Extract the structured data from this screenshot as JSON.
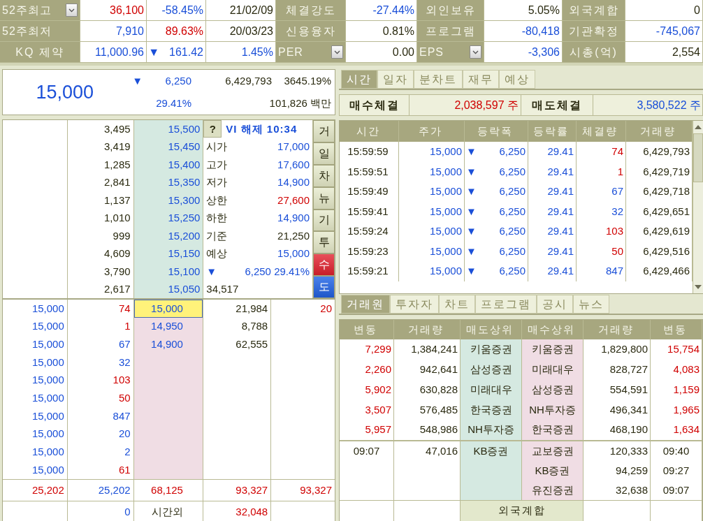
{
  "info_bar": {
    "rows": [
      {
        "cells": [
          {
            "kind": "select",
            "text": "52주최고"
          },
          {
            "kind": "value",
            "text": "36,100",
            "color": "#d00000"
          },
          {
            "kind": "value",
            "text": "-58.45%",
            "color": "#1a4fd8"
          },
          {
            "kind": "value",
            "text": "21/02/09",
            "color": "#2a2a10"
          },
          {
            "kind": "label",
            "text": "체결강도"
          },
          {
            "kind": "value",
            "text": "-27.44%",
            "color": "#1a4fd8"
          },
          {
            "kind": "label",
            "text": "외인보유"
          },
          {
            "kind": "value",
            "text": "5.05%",
            "color": "#2a2a10"
          },
          {
            "kind": "label",
            "text": "외국계합"
          },
          {
            "kind": "value",
            "text": "0",
            "color": "#2a2a10"
          }
        ]
      },
      {
        "cells": [
          {
            "kind": "label",
            "text": "52주최저"
          },
          {
            "kind": "value",
            "text": "7,910",
            "color": "#1a4fd8"
          },
          {
            "kind": "value",
            "text": "89.63%",
            "color": "#d00000"
          },
          {
            "kind": "value",
            "text": "20/03/23",
            "color": "#2a2a10"
          },
          {
            "kind": "label",
            "text": "신용융자"
          },
          {
            "kind": "value",
            "text": "0.81%",
            "color": "#2a2a10"
          },
          {
            "kind": "label",
            "text": "프로그램"
          },
          {
            "kind": "value",
            "text": "-80,418",
            "color": "#1a4fd8"
          },
          {
            "kind": "label",
            "text": "기관확정"
          },
          {
            "kind": "value",
            "text": "-745,067",
            "color": "#1a4fd8"
          }
        ]
      },
      {
        "cells": [
          {
            "kind": "label",
            "text": "KQ 제약"
          },
          {
            "kind": "value",
            "text": "11,000.96",
            "color": "#1a4fd8"
          },
          {
            "kind": "value",
            "sign": "▼",
            "text": "161.42",
            "color": "#1a4fd8"
          },
          {
            "kind": "value",
            "text": "1.45%",
            "color": "#1a4fd8"
          },
          {
            "kind": "select",
            "text": "PER"
          },
          {
            "kind": "value",
            "text": "0.00",
            "color": "#2a2a10"
          },
          {
            "kind": "select",
            "text": "EPS"
          },
          {
            "kind": "value",
            "text": "-3,306",
            "color": "#1a4fd8"
          },
          {
            "kind": "label",
            "text": "시총(억)"
          },
          {
            "kind": "value",
            "text": "2,554",
            "color": "#2a2a10"
          }
        ]
      }
    ]
  },
  "quote": {
    "price": "15,000",
    "sign": "▼",
    "change": "6,250",
    "rate": "29.41%",
    "volume": "6,429,793",
    "volume_ratio": "3645.19%",
    "amount": "101,826 백만"
  },
  "order_book": {
    "asks": [
      {
        "qty": "3,495",
        "price": "15,500"
      },
      {
        "qty": "3,419",
        "price": "15,450"
      },
      {
        "qty": "1,285",
        "price": "15,400"
      },
      {
        "qty": "2,841",
        "price": "15,350"
      },
      {
        "qty": "1,137",
        "price": "15,300"
      },
      {
        "qty": "1,010",
        "price": "15,250"
      },
      {
        "qty": "999",
        "price": "15,200"
      },
      {
        "qty": "4,609",
        "price": "15,150"
      },
      {
        "qty": "3,790",
        "price": "15,100"
      },
      {
        "qty": "2,617",
        "price": "15,050"
      }
    ],
    "info": {
      "help_button": "?",
      "vi_status": "VI 해제 10:34",
      "stats": [
        {
          "label": "시가",
          "value": "17,000",
          "color": "#1a4fd8"
        },
        {
          "label": "고가",
          "value": "17,600",
          "color": "#1a4fd8"
        },
        {
          "label": "저가",
          "value": "14,900",
          "color": "#1a4fd8"
        },
        {
          "label": "상한",
          "value": "27,600",
          "color": "#d00000"
        },
        {
          "label": "하한",
          "value": "14,900",
          "color": "#1a4fd8"
        },
        {
          "label": "기준",
          "value": "21,250",
          "color": "#2a2a10"
        },
        {
          "label": "예상",
          "value": "15,000",
          "color": "#1a4fd8"
        }
      ],
      "expected": {
        "sign": "▼",
        "change": "6,250 29.41%",
        "volume": "34,517"
      }
    },
    "side_buttons": [
      {
        "label": "거",
        "kind": "plain"
      },
      {
        "label": "일",
        "kind": "plain"
      },
      {
        "label": "차",
        "kind": "plain"
      },
      {
        "label": "뉴",
        "kind": "plain"
      },
      {
        "label": "기",
        "kind": "plain"
      },
      {
        "label": "투",
        "kind": "plain"
      },
      {
        "label": "수",
        "kind": "buy"
      },
      {
        "label": "도",
        "kind": "sell"
      }
    ],
    "bids": [
      {
        "trade_price": "15,000",
        "trade_qty": {
          "text": "74",
          "color": "#d00000"
        },
        "price": "15,000",
        "selected": true,
        "qty": "21,984",
        "change": {
          "text": "20",
          "color": "#d00000"
        }
      },
      {
        "trade_price": "15,000",
        "trade_qty": {
          "text": "1",
          "color": "#d00000"
        },
        "price": "14,950",
        "selected": false,
        "qty": "8,788"
      },
      {
        "trade_price": "15,000",
        "trade_qty": {
          "text": "67",
          "color": "#1a4fd8"
        },
        "price": "14,900",
        "selected": false,
        "qty": "62,555"
      },
      {
        "trade_price": "15,000",
        "trade_qty": {
          "text": "32",
          "color": "#1a4fd8"
        },
        "selected": false
      },
      {
        "trade_price": "15,000",
        "trade_qty": {
          "text": "103",
          "color": "#d00000"
        },
        "selected": false
      },
      {
        "trade_price": "15,000",
        "trade_qty": {
          "text": "50",
          "color": "#d00000"
        },
        "selected": false
      },
      {
        "trade_price": "15,000",
        "trade_qty": {
          "text": "847",
          "color": "#1a4fd8"
        },
        "selected": false
      },
      {
        "trade_price": "15,000",
        "trade_qty": {
          "text": "20",
          "color": "#1a4fd8"
        },
        "selected": false
      },
      {
        "trade_price": "15,000",
        "trade_qty": {
          "text": "2",
          "color": "#1a4fd8"
        },
        "selected": false
      },
      {
        "trade_price": "15,000",
        "trade_qty": {
          "text": "61",
          "color": "#d00000"
        },
        "selected": false
      }
    ],
    "totals": [
      {
        "text": "25,202",
        "color": "#d00000"
      },
      {
        "text": "25,202",
        "color": "#1a4fd8"
      },
      {
        "text": "68,125",
        "color": "#d00000"
      },
      {
        "text": "93,327",
        "color": "#d00000"
      },
      {
        "text": "93,327",
        "color": "#d00000"
      }
    ],
    "after_hours": {
      "qty": {
        "text": "0",
        "color": "#1a4fd8"
      },
      "label": "시간외",
      "volume": {
        "text": "32,048",
        "color": "#d00000"
      }
    }
  },
  "trade_tabs": [
    {
      "label": "시간",
      "selected": true
    },
    {
      "label": "일자",
      "selected": false
    },
    {
      "label": "분차트",
      "selected": false
    },
    {
      "label": "재무",
      "selected": false
    },
    {
      "label": "예상",
      "selected": false
    }
  ],
  "trade_summary": {
    "buy_label": "매수체결",
    "buy_volume": "2,038,597 주",
    "sell_label": "매도체결",
    "sell_volume": "3,580,522 주"
  },
  "trades": {
    "columns": [
      "시간",
      "주가",
      "등락폭",
      "등락률",
      "체결량",
      "거래량"
    ],
    "rows": [
      {
        "time": "15:59:59",
        "price": "15,000",
        "sign": "▼",
        "change": "6,250",
        "rate": "29.41",
        "qty": {
          "text": "74",
          "color": "#d00000"
        },
        "volume": "6,429,793"
      },
      {
        "time": "15:59:51",
        "price": "15,000",
        "sign": "▼",
        "change": "6,250",
        "rate": "29.41",
        "qty": {
          "text": "1",
          "color": "#d00000"
        },
        "volume": "6,429,719"
      },
      {
        "time": "15:59:49",
        "price": "15,000",
        "sign": "▼",
        "change": "6,250",
        "rate": "29.41",
        "qty": {
          "text": "67",
          "color": "#1a4fd8"
        },
        "volume": "6,429,718"
      },
      {
        "time": "15:59:41",
        "price": "15,000",
        "sign": "▼",
        "change": "6,250",
        "rate": "29.41",
        "qty": {
          "text": "32",
          "color": "#1a4fd8"
        },
        "volume": "6,429,651"
      },
      {
        "time": "15:59:24",
        "price": "15,000",
        "sign": "▼",
        "change": "6,250",
        "rate": "29.41",
        "qty": {
          "text": "103",
          "color": "#d00000"
        },
        "volume": "6,429,619"
      },
      {
        "time": "15:59:23",
        "price": "15,000",
        "sign": "▼",
        "change": "6,250",
        "rate": "29.41",
        "qty": {
          "text": "50",
          "color": "#d00000"
        },
        "volume": "6,429,516"
      },
      {
        "time": "15:59:21",
        "price": "15,000",
        "sign": "▼",
        "change": "6,250",
        "rate": "29.41",
        "qty": {
          "text": "847",
          "color": "#1a4fd8"
        },
        "volume": "6,429,466"
      }
    ]
  },
  "broker_tabs": [
    {
      "label": "거래원",
      "selected": true
    },
    {
      "label": "투자자",
      "selected": false
    },
    {
      "label": "차트",
      "selected": false
    },
    {
      "label": "프로그램",
      "selected": false
    },
    {
      "label": "공시",
      "selected": false
    },
    {
      "label": "뉴스",
      "selected": false
    }
  ],
  "brokers": {
    "columns": [
      "변동",
      "거래량",
      "매도상위",
      "매수상위",
      "거래량",
      "변동"
    ],
    "rows": [
      {
        "sell_change": {
          "text": "7,299",
          "color": "#d00000"
        },
        "sell_volume": "1,384,241",
        "seller": "키움증권",
        "buyer": "키움증권",
        "buy_volume": "1,829,800",
        "buy_change": {
          "text": "15,754",
          "color": "#d00000"
        }
      },
      {
        "sell_change": {
          "text": "2,260",
          "color": "#d00000"
        },
        "sell_volume": "942,641",
        "seller": "삼성증권",
        "buyer": "미래대우",
        "buy_volume": "828,727",
        "buy_change": {
          "text": "4,083",
          "color": "#d00000"
        }
      },
      {
        "sell_change": {
          "text": "5,902",
          "color": "#d00000"
        },
        "sell_volume": "630,828",
        "seller": "미래대우",
        "buyer": "삼성증권",
        "buy_volume": "554,591",
        "buy_change": {
          "text": "1,159",
          "color": "#d00000"
        }
      },
      {
        "sell_change": {
          "text": "3,507",
          "color": "#d00000"
        },
        "sell_volume": "576,485",
        "seller": "한국증권",
        "buyer": "NH투자증",
        "buy_volume": "496,341",
        "buy_change": {
          "text": "1,965",
          "color": "#d00000"
        }
      },
      {
        "sell_change": {
          "text": "5,957",
          "color": "#d00000"
        },
        "sell_volume": "548,986",
        "seller": "NH투자증",
        "buyer": "한국증권",
        "buy_volume": "468,190",
        "buy_change": {
          "text": "1,634",
          "color": "#d00000"
        }
      }
    ],
    "foreign_rows": [
      {
        "sell_time": "09:07",
        "sell_volume": "47,016",
        "seller": "KB증권",
        "buyer": "교보증권",
        "buy_volume": "120,333",
        "buy_time": "09:40"
      },
      {
        "buyer": "KB증권",
        "buy_volume": "94,259",
        "buy_time": "09:27"
      },
      {
        "buyer": "유진증권",
        "buy_volume": "32,638",
        "buy_time": "09:07"
      }
    ],
    "footer": "외국계합"
  }
}
